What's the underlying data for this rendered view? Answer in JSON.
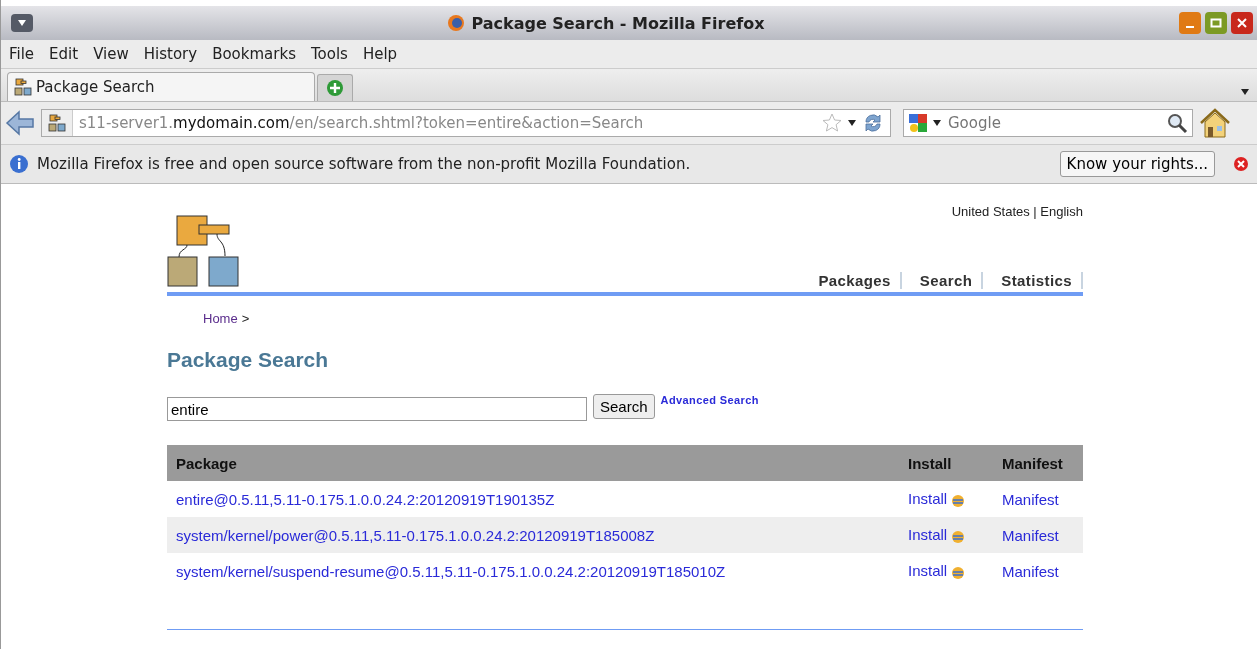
{
  "window": {
    "title": "Package Search - Mozilla Firefox"
  },
  "menu": [
    "File",
    "Edit",
    "View",
    "History",
    "Bookmarks",
    "Tools",
    "Help"
  ],
  "tabs": [
    {
      "label": "Package Search",
      "selected": true
    }
  ],
  "url": "s11-server1.**mydomain.com**/en/search.shtml?token=entire&action=Search",
  "search_engine": {
    "placeholder": "Google"
  },
  "notification": {
    "text": "Mozilla Firefox is free and open source software from the non-profit Mozilla Foundation.",
    "button": "Know your rights..."
  },
  "page": {
    "locale": "United States | English",
    "nav": [
      "Packages",
      "Search",
      "Statistics"
    ],
    "breadcrumb": {
      "link": "Home",
      "separator": ">"
    },
    "heading": "Package Search",
    "search": {
      "value": "entire",
      "button": "Search",
      "advanced": "Advanced Search"
    },
    "table": {
      "columns": [
        "Package",
        "Install",
        "Manifest"
      ],
      "rows": [
        {
          "package": "entire@0.5.11,5.11-0.175.1.0.0.24.2:20120919T190135Z",
          "install": "Install",
          "manifest": "Manifest"
        },
        {
          "package": "system/kernel/power@0.5.11,5.11-0.175.1.0.0.24.2:20120919T185008Z",
          "install": "Install",
          "manifest": "Manifest"
        },
        {
          "package": "system/kernel/suspend-resume@0.5.11,5.11-0.175.1.0.0.24.2:20120919T185010Z",
          "install": "Install",
          "manifest": "Manifest"
        }
      ]
    }
  }
}
